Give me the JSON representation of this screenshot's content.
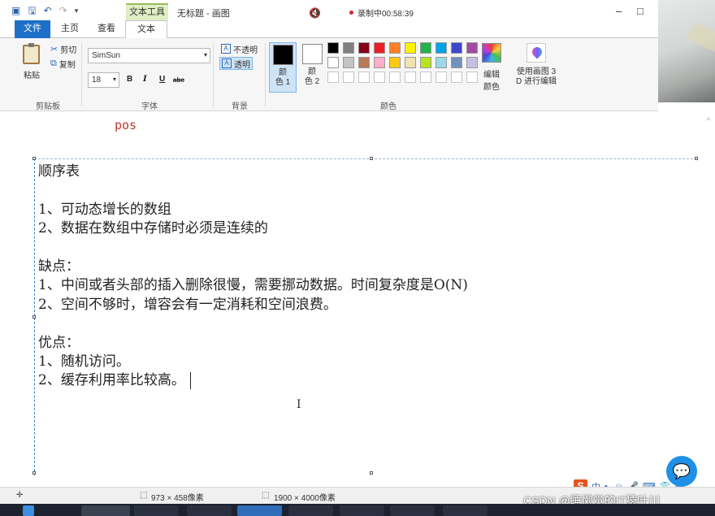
{
  "window": {
    "contextual_tab": "文本工具",
    "title": "无标题 - 画图",
    "recording": "录制中00:58:39",
    "controls": [
      "–",
      "□"
    ]
  },
  "tabs": [
    {
      "label": "文件"
    },
    {
      "label": "主页"
    },
    {
      "label": "查看"
    },
    {
      "label": "文本"
    }
  ],
  "clipboard": {
    "paste": "粘贴",
    "cut": "剪切",
    "copy": "复制",
    "group": "剪贴板"
  },
  "font": {
    "family": "SimSun",
    "size": "18",
    "bold": "B",
    "italic": "I",
    "underline": "U",
    "strike": "abc",
    "group": "字体"
  },
  "background": {
    "opaque": "不透明",
    "transparent": "透明",
    "group": "背景"
  },
  "colors": {
    "color1_line1": "颜",
    "color1_line2": "色 1",
    "color2_line1": "颜",
    "color2_line2": "色 2",
    "edit_line1": "编辑",
    "edit_line2": "颜色",
    "paint3d_line1": "使用画图 3",
    "paint3d_line2": "D 进行编辑",
    "group": "颜色",
    "color1": "#000000",
    "color2": "#ffffff",
    "palette": [
      "#000000",
      "#7f7f7f",
      "#880015",
      "#ed1c24",
      "#ff7f27",
      "#fff200",
      "#22b14c",
      "#00a2e8",
      "#3f48cc",
      "#a349a4",
      "#ffffff",
      "#c3c3c3",
      "#b97a57",
      "#ffaec9",
      "#ffc90e",
      "#efe4b0",
      "#b5e61d",
      "#99d9ea",
      "#7092be",
      "#c8bfe7"
    ]
  },
  "canvas": {
    "pos_label": "pos",
    "lines": [
      "顺序表",
      "",
      "1、可动态增长的数组",
      "2、数据在数组中存储时必须是连续的",
      "",
      "缺点：",
      "1、中间或者头部的插入删除很慢，需要挪动数据。时间复杂度是O(N)",
      "2、空间不够时，增容会有一定消耗和空间浪费。",
      "",
      "优点：",
      "1、随机访问。",
      "2、缓存利用率比较高。"
    ]
  },
  "status": {
    "selection": "973 × 458像素",
    "canvas_size": "1900 × 4000像素"
  },
  "ime": {
    "logo": "S",
    "mode": "中"
  },
  "watermark": "CSDN @睡懒觉的IT猿叶川"
}
